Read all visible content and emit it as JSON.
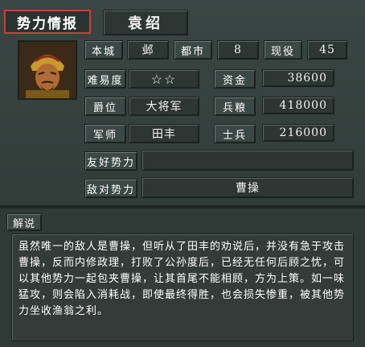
{
  "header": {
    "title": "势力情报",
    "faction_name": "袁绍"
  },
  "portrait": {
    "icon": "general-portrait-icon"
  },
  "stats": {
    "capital_label": "本城",
    "capital_value": "邺",
    "cities_label": "都市",
    "cities_value": "8",
    "officers_label": "现役",
    "officers_value": "45",
    "difficulty_label": "难易度",
    "difficulty_value": "☆☆",
    "funds_label": "资金",
    "funds_value": "38600",
    "rank_label": "爵位",
    "rank_value": "大将军",
    "food_label": "兵粮",
    "food_value": "418000",
    "strategist_label": "军师",
    "strategist_value": "田丰",
    "soldiers_label": "士兵",
    "soldiers_value": "216000",
    "allies_label": "友好势力",
    "allies_value": "",
    "enemies_label": "敌对势力",
    "enemies_value": "曹操"
  },
  "description": {
    "label": "解说",
    "text": "虽然唯一的敌人是曹操，但听从了田丰的劝说后，并没有急于攻击曹操，反而内修政理，打败了公孙度后，已经无任何后顾之忧，可以其他势力一起包夹曹操，让其首尾不能相顾，方为上策。如一味猛攻，则会陷入消耗战，即使最终得胜，也会损失惨重，被其他势力坐收渔翁之利。"
  },
  "colors": {
    "background": "#2f3a37",
    "title_border": "#c0443c"
  }
}
